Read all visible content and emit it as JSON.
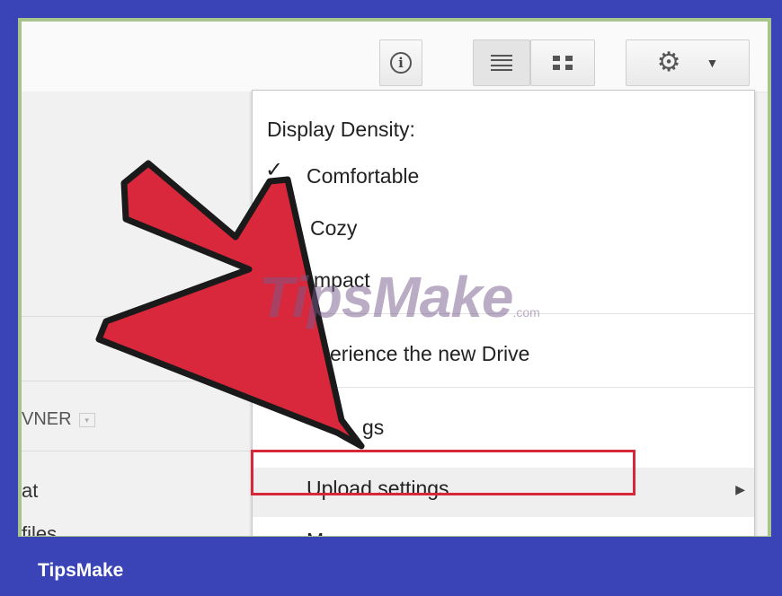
{
  "toolbar": {
    "info_icon": "info-icon",
    "list_view_icon": "list-view-icon",
    "grid_view_icon": "grid-view-icon",
    "settings_icon": "gear-icon"
  },
  "left_pane": {
    "owner_header": "VNER",
    "rows": [
      "at",
      "files"
    ]
  },
  "menu": {
    "title": "Display Density:",
    "comfortable": "Comfortable",
    "cozy": "Cozy",
    "compact": "mpact",
    "new_drive": "erience the new Drive",
    "settings": "gs",
    "upload_settings": "Upload settings",
    "manage_apps": "Manage apps"
  },
  "watermark": {
    "text": "TipsMake",
    "suffix": ".com"
  },
  "footer": {
    "brand": "TipsMake"
  },
  "colors": {
    "frame_blue": "#3a44b6",
    "highlight_red": "#d7283a",
    "arrow_red": "#d9283b"
  }
}
